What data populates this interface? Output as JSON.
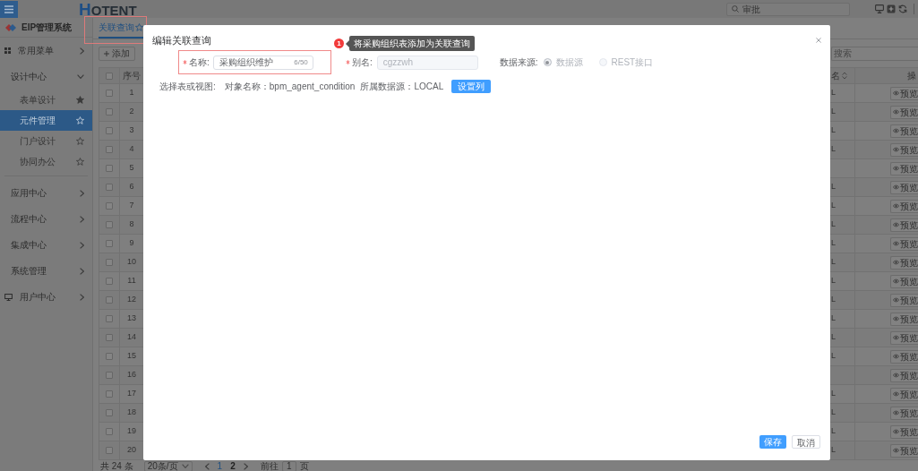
{
  "header": {
    "logo": "HOTENT",
    "search": {
      "placeholder": "审批"
    }
  },
  "sidebar": {
    "title": "EIP管理系统",
    "items": [
      {
        "label": "常用菜单",
        "expanded": false
      },
      {
        "label": "设计中心",
        "expanded": true,
        "children": [
          {
            "label": "表单设计",
            "selected": false,
            "starred": true
          },
          {
            "label": "元件管理",
            "selected": true,
            "starred": false
          },
          {
            "label": "门户设计",
            "selected": false,
            "starred": false
          },
          {
            "label": "协同办公",
            "selected": false,
            "starred": false
          }
        ]
      },
      {
        "label": "应用中心",
        "expanded": false
      },
      {
        "label": "流程中心",
        "expanded": false
      },
      {
        "label": "集成中心",
        "expanded": false
      },
      {
        "label": "系统管理",
        "expanded": false
      },
      {
        "label": "用户中心",
        "expanded": false
      }
    ]
  },
  "tabs": [
    {
      "label": "关联查询",
      "selected": true
    }
  ],
  "toolbar": {
    "add_button": "添加",
    "search": {
      "placeholder": "搜索"
    }
  },
  "table": {
    "header_checked": false,
    "columns": [
      {
        "kind": "index",
        "label": "序号"
      },
      {
        "kind": "text",
        "label": "名",
        "sortable": true
      },
      {
        "kind": "actions",
        "label": "操"
      }
    ],
    "rows": [
      {
        "checked": false,
        "index": "1",
        "column_3": "L",
        "action": "预览"
      },
      {
        "checked": false,
        "index": "2",
        "column_3": "L",
        "action": "预览"
      },
      {
        "checked": false,
        "index": "3",
        "column_3": "L",
        "action": "预览"
      },
      {
        "checked": false,
        "index": "4",
        "column_3": "L",
        "action": "预览"
      },
      {
        "checked": false,
        "index": "5",
        "action": "预览"
      },
      {
        "checked": false,
        "index": "6",
        "column_3": "L",
        "action": "预览"
      },
      {
        "checked": false,
        "index": "7",
        "column_3": "L",
        "action": "预览"
      },
      {
        "checked": false,
        "index": "8",
        "column_3": "L",
        "action": "预览"
      },
      {
        "checked": false,
        "index": "9",
        "column_3": "L",
        "action": "预览"
      },
      {
        "checked": false,
        "index": "10",
        "column_3": "L",
        "action": "预览"
      },
      {
        "checked": false,
        "index": "11",
        "column_3": "L",
        "action": "预览"
      },
      {
        "checked": false,
        "index": "12",
        "column_3": "L",
        "action": "预览"
      },
      {
        "checked": false,
        "index": "13",
        "column_3": "L",
        "action": "预览"
      },
      {
        "checked": false,
        "index": "14",
        "column_3": "L",
        "action": "预览"
      },
      {
        "checked": false,
        "index": "15",
        "column_3": "L",
        "action": "预览"
      },
      {
        "checked": false,
        "index": "16",
        "action": "预览"
      },
      {
        "checked": false,
        "index": "17",
        "column_3": "L",
        "action": "预览"
      },
      {
        "checked": false,
        "index": "18",
        "column_3": "L",
        "action": "预览"
      },
      {
        "checked": false,
        "index": "19",
        "column_3": "L",
        "action": "预览"
      },
      {
        "checked": false,
        "index": "20",
        "column_3": "L",
        "action": "预览"
      }
    ]
  },
  "pagination": {
    "total": "共 24 条",
    "page_size": "20条/页",
    "pages": [
      {
        "label": "1",
        "selected": true
      },
      {
        "label": "2",
        "selected": false
      }
    ],
    "goto_label": "前往",
    "goto_value": "1",
    "goto_suffix": "页"
  },
  "dialog": {
    "title": "编辑关联查询",
    "name_field": {
      "label": "名称:",
      "required": true,
      "value": "采购组织维护",
      "count": "6/50"
    },
    "alias_field": {
      "label": "别名:",
      "required": true,
      "value": "cgzzwh",
      "disabled": true
    },
    "data_source": {
      "label": "数据来源:",
      "disabled": true,
      "options": [
        {
          "label": "数据源",
          "selected": true
        },
        {
          "label": "REST接口",
          "selected": false
        }
      ]
    },
    "table_select": {
      "label": "选择表或视图:",
      "object": "对象名称：bpm_agent_condition",
      "source": "所属数据源：LOCAL",
      "button": "设置列"
    },
    "buttons": [
      {
        "label": "保存",
        "kind": "primary"
      },
      {
        "label": "取消",
        "kind": "default"
      }
    ]
  },
  "annotation": {
    "badge": "1",
    "tooltip": "将采购组织表添加为关联查询"
  }
}
